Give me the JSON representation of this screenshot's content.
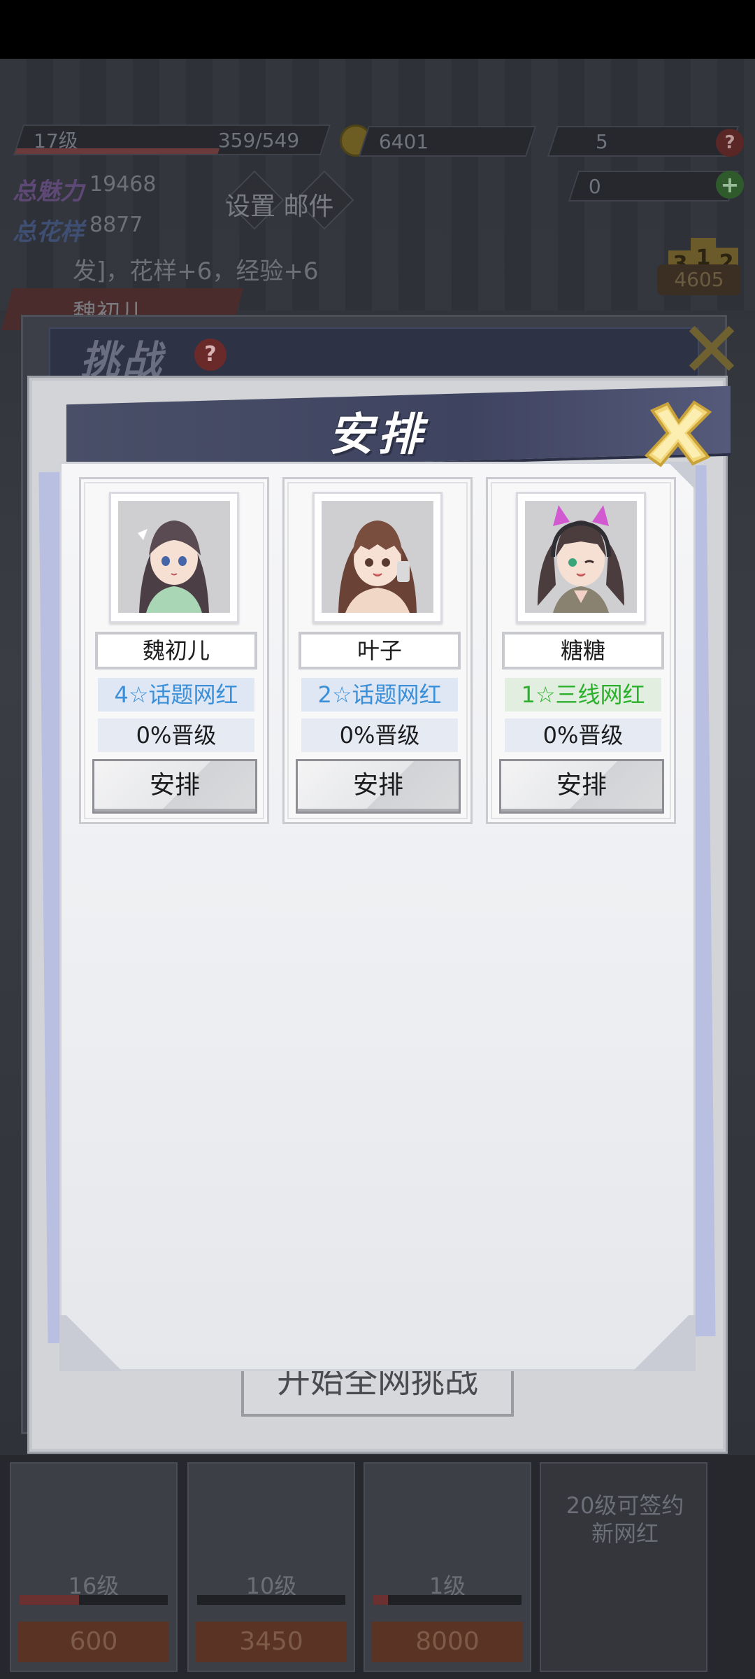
{
  "background": {
    "level": "17级",
    "exp": "359/549",
    "gold": "6401",
    "roses": "5",
    "diamonds": "0",
    "total_charm_label": "总魅力",
    "total_charm": "19468",
    "total_talent_label": "总花样",
    "total_talent": "8877",
    "menu_label": "设置 邮件",
    "event_text": "发]，花样+6，经验+6",
    "ranking_score": "4605",
    "podium": [
      "3",
      "1",
      "2"
    ],
    "tab_name": "魏初儿",
    "challenge_title": "挑战",
    "help_mark": "?",
    "start_button": "开始全网挑战",
    "bottom_cards": [
      {
        "level": "16级",
        "price": "600"
      },
      {
        "level": "10级",
        "price": "3450"
      },
      {
        "level": "1级",
        "price": "8000"
      },
      {
        "note": "20级可签约新网红"
      }
    ]
  },
  "modal": {
    "title": "安排",
    "close_icon": "close-x-icon",
    "characters": [
      {
        "name": "魏初儿",
        "rank": "4☆话题网红",
        "rank_color": "#3a8fd8",
        "promotion": "0%晋级",
        "button": "安排"
      },
      {
        "name": "叶子",
        "rank": "2☆话题网红",
        "rank_color": "#3a8fd8",
        "promotion": "0%晋级",
        "button": "安排"
      },
      {
        "name": "糖糖",
        "rank": "1☆三线网红",
        "rank_color": "#2bb02b",
        "promotion": "0%晋级",
        "button": "安排"
      }
    ]
  }
}
